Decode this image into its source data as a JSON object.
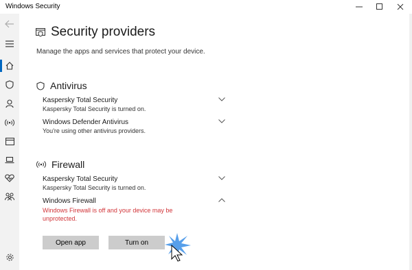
{
  "window": {
    "title": "Windows Security",
    "controls": [
      "minimize",
      "maximize",
      "close"
    ]
  },
  "sidebar": {
    "items": [
      {
        "icon": "back-arrow-icon"
      },
      {
        "icon": "menu-icon"
      },
      {
        "icon": "home-icon",
        "active": true
      },
      {
        "icon": "shield-icon"
      },
      {
        "icon": "person-icon"
      },
      {
        "icon": "wireless-icon"
      },
      {
        "icon": "app-browser-icon"
      },
      {
        "icon": "laptop-icon"
      },
      {
        "icon": "heart-icon"
      },
      {
        "icon": "family-icon"
      },
      {
        "icon": "gear-icon"
      }
    ],
    "accent": "#0067c0"
  },
  "page": {
    "title": "Security providers",
    "description": "Manage the apps and services that protect your device."
  },
  "antivirus": {
    "title": "Antivirus",
    "providers": [
      {
        "name": "Kaspersky Total Security",
        "status": "Kaspersky Total Security is turned on."
      },
      {
        "name": "Windows Defender Antivirus",
        "status": "You're using other antivirus providers."
      }
    ]
  },
  "firewall": {
    "title": "Firewall",
    "providers": [
      {
        "name": "Kaspersky Total Security",
        "status": "Kaspersky Total Security is turned on."
      },
      {
        "name": "Windows Firewall",
        "status": "Windows Firewall is off and your device may be unprotected.",
        "expanded": true
      }
    ],
    "buttons": {
      "open_app": "Open app",
      "turn_on": "Turn on"
    }
  },
  "colors": {
    "warning": "#d13438",
    "button": "#cccccc",
    "sidebar": "#f2f2f2"
  }
}
